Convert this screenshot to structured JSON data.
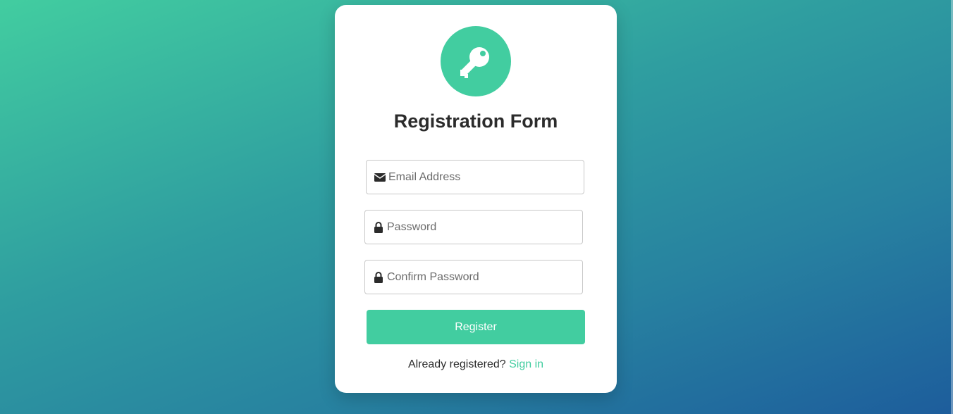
{
  "form": {
    "title": "Registration Form",
    "logo_icon": "key-icon",
    "fields": [
      {
        "name": "email",
        "icon": "envelope-icon",
        "placeholder": "Email Address",
        "value": ""
      },
      {
        "name": "password",
        "icon": "lock-icon",
        "placeholder": "Password",
        "value": ""
      },
      {
        "name": "confirm_password",
        "icon": "lock-icon",
        "placeholder": "Confirm Password",
        "value": ""
      }
    ],
    "register_label": "Register",
    "footer_text": "Already registered? ",
    "signin_label": "Sign in"
  },
  "colors": {
    "accent": "#42cda0",
    "card": "#ffffff",
    "text": "#2b2b2b",
    "gradient_start": "#42cda0",
    "gradient_end": "#1d5d9c"
  }
}
